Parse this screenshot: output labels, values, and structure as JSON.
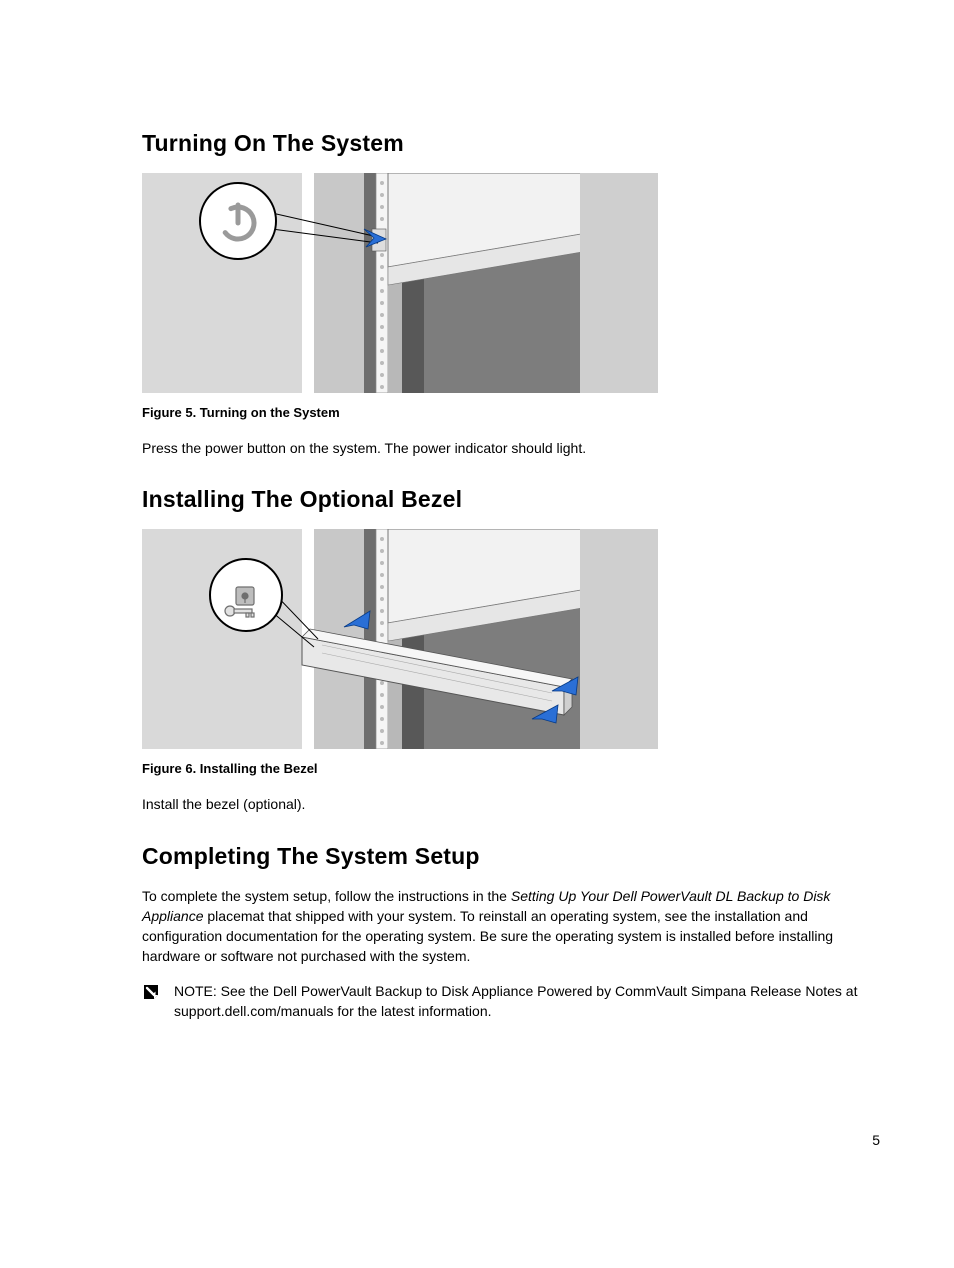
{
  "section1": {
    "heading": "Turning On The System",
    "figcap": "Figure 5. Turning on the System",
    "body": "Press the power button on the system. The power indicator should light."
  },
  "section2": {
    "heading": "Installing The Optional Bezel",
    "figcap": "Figure 6. Installing the Bezel",
    "body": "Install the bezel (optional)."
  },
  "section3": {
    "heading": "Completing The System Setup",
    "body_pre": "To complete the system setup, follow the instructions in the ",
    "body_italic1": "Setting Up Your Dell PowerVault DL Backup to Disk Appliance",
    "body_post": " placemat that shipped with your system. To reinstall an operating system, see the installation and configuration documentation for the operating system. Be sure the operating system is installed before installing hardware or software not purchased with the system.",
    "note_label": "NOTE:",
    "note_pre": " See the ",
    "note_italic": "Dell PowerVault Backup to Disk Appliance Powered by CommVault Simpana Release Notes",
    "note_mid": " at ",
    "note_bold": "support.dell.com/manuals",
    "note_post": " for the latest information."
  },
  "page_number": "5"
}
